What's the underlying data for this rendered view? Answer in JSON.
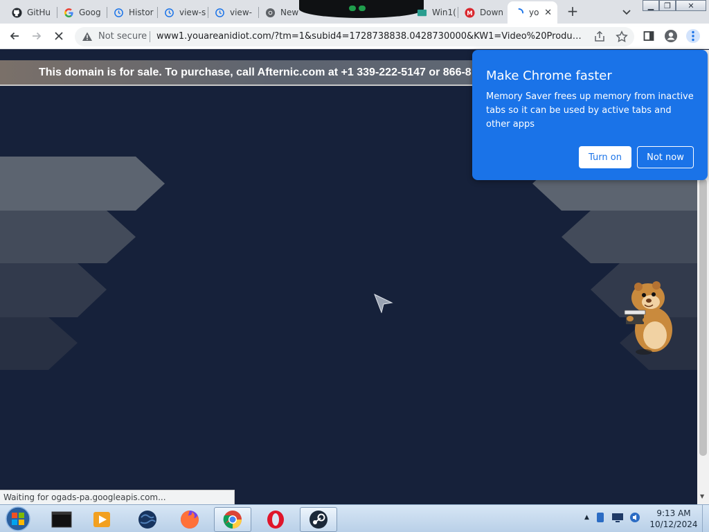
{
  "tabs": [
    {
      "title": "GitHu",
      "icon": "github-icon"
    },
    {
      "title": "Goog",
      "icon": "google-icon"
    },
    {
      "title": "Histor",
      "icon": "history-icon"
    },
    {
      "title": "view-s",
      "icon": "history-icon"
    },
    {
      "title": "view-",
      "icon": "history-icon"
    },
    {
      "title": "New",
      "icon": "chrome-icon"
    },
    {
      "title": "Win1(",
      "icon": "window-icon"
    },
    {
      "title": "Down",
      "icon": "mega-icon"
    },
    {
      "title": "yo",
      "icon": "loading-spinner-icon",
      "active": true
    }
  ],
  "toolbar": {
    "security_label": "Not secure",
    "url": "www1.youareanidiot.com/?tm=1&subid4=1728738838.0428730000&KW1=Video%20Productions..."
  },
  "page": {
    "sale_banner": "This domain is for sale. To purchase, call Afternic.com at +1 339-222-5147 or 866-8",
    "status_text": "Waiting for ogads-pa.googleapis.com..."
  },
  "popup": {
    "title": "Make Chrome faster",
    "body": "Memory Saver frees up memory from inactive tabs so it can be used by active tabs and other apps",
    "turn_on_label": "Turn on",
    "not_now_label": "Not now"
  },
  "taskbar": {
    "apps": [
      "terminal-icon",
      "media-player-icon",
      "earth-icon",
      "firefox-icon",
      "chrome-icon",
      "opera-icon",
      "steam-icon"
    ],
    "time": "9:13 AM",
    "date": "10/12/2024"
  },
  "colors": {
    "page_bg": "#16213a",
    "popup_bg": "#1a73e8",
    "tabstrip_bg": "#dee1e6"
  }
}
